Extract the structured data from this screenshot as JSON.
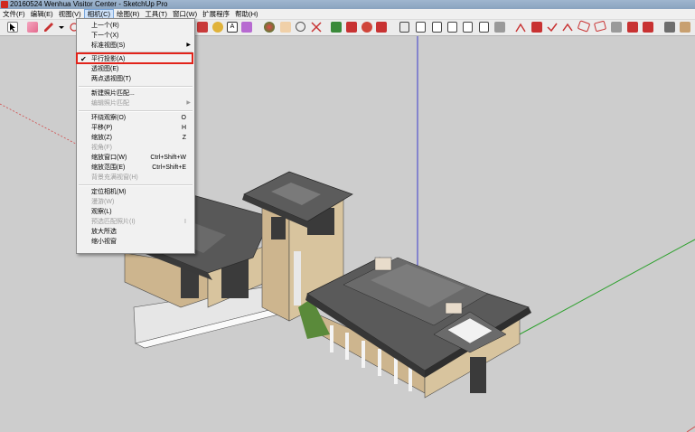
{
  "window": {
    "title": "20160524 Wenhua Visitor Center - SketchUp Pro"
  },
  "menubar": {
    "items": [
      {
        "label": "文件(F)"
      },
      {
        "label": "编辑(E)"
      },
      {
        "label": "视图(V)"
      },
      {
        "label": "相机(C)"
      },
      {
        "label": "绘图(R)"
      },
      {
        "label": "工具(T)"
      },
      {
        "label": "窗口(W)"
      },
      {
        "label": "扩展程序"
      },
      {
        "label": "帮助(H)"
      }
    ]
  },
  "camera_menu": {
    "items": [
      {
        "label": "上一个(R)",
        "shortcut": "",
        "disabled": false,
        "submenu": false,
        "checked": false
      },
      {
        "label": "下一个(X)",
        "shortcut": "",
        "disabled": false,
        "submenu": false,
        "checked": false
      },
      {
        "label": "标准视图(S)",
        "shortcut": "",
        "disabled": false,
        "submenu": true,
        "checked": false
      },
      {
        "label": "平行投影(A)",
        "shortcut": "",
        "disabled": false,
        "submenu": false,
        "checked": true
      },
      {
        "label": "透视图(E)",
        "shortcut": "",
        "disabled": false,
        "submenu": false,
        "checked": false
      },
      {
        "label": "两点透视图(T)",
        "shortcut": "",
        "disabled": false,
        "submenu": false,
        "checked": false
      },
      {
        "label": "新建照片匹配...",
        "shortcut": "",
        "disabled": false,
        "submenu": false,
        "checked": false
      },
      {
        "label": "编辑照片匹配",
        "shortcut": "",
        "disabled": true,
        "submenu": true,
        "checked": false
      },
      {
        "label": "环绕观察(O)",
        "shortcut": "O",
        "disabled": false,
        "submenu": false,
        "checked": false
      },
      {
        "label": "平移(P)",
        "shortcut": "H",
        "disabled": false,
        "submenu": false,
        "checked": false
      },
      {
        "label": "缩放(Z)",
        "shortcut": "Z",
        "disabled": false,
        "submenu": false,
        "checked": false
      },
      {
        "label": "视角(F)",
        "shortcut": "",
        "disabled": true,
        "submenu": false,
        "checked": false
      },
      {
        "label": "缩放窗口(W)",
        "shortcut": "Ctrl+Shift+W",
        "disabled": false,
        "submenu": false,
        "checked": false
      },
      {
        "label": "缩放范围(E)",
        "shortcut": "Ctrl+Shift+E",
        "disabled": false,
        "submenu": false,
        "checked": false
      },
      {
        "label": "背景充满视窗(H)",
        "shortcut": "",
        "disabled": true,
        "submenu": false,
        "checked": false
      },
      {
        "label": "定位相机(M)",
        "shortcut": "",
        "disabled": false,
        "submenu": false,
        "checked": false
      },
      {
        "label": "漫游(W)",
        "shortcut": "",
        "disabled": true,
        "submenu": false,
        "checked": false
      },
      {
        "label": "观察(L)",
        "shortcut": "",
        "disabled": false,
        "submenu": false,
        "checked": false
      },
      {
        "label": "预选匹配照片(I)",
        "shortcut": "I",
        "disabled": true,
        "submenu": false,
        "checked": false
      },
      {
        "label": "放大所选",
        "shortcut": "",
        "disabled": false,
        "submenu": false,
        "checked": false
      },
      {
        "label": "缩小视窗",
        "shortcut": "",
        "disabled": false,
        "submenu": false,
        "checked": false
      }
    ]
  },
  "toolbar": {
    "icons": [
      "select-icon",
      "eraser-icon",
      "pencil-icon",
      "dropdown-arrow-icon",
      "arc-icon",
      "move-icon",
      "push-pull-icon",
      "rotate-icon",
      "follow-me-icon",
      "scale-icon",
      "offset-icon",
      "tape-measure-icon",
      "text-icon",
      "paint-bucket-icon",
      "orbit-icon",
      "pan-icon",
      "zoom-icon",
      "zoom-extents-icon",
      "warehouse-icon",
      "extension-icon",
      "style-icon",
      "component-icon",
      "shadow-icon",
      "section-icon",
      "face-icon",
      "iso-view-icon",
      "top-view-icon",
      "front-view-icon",
      "right-view-icon",
      "back-view-icon",
      "left-view-icon",
      "xray-icon",
      "wireframe-icon",
      "hidden-line-icon",
      "shaded-icon",
      "textured-icon",
      "monochrome-icon",
      "sandbox-icon",
      "stamp-icon",
      "drape-icon",
      "flip-icon",
      "smoove-icon",
      "add-detail-icon",
      "geolocation-icon",
      "model-info-icon"
    ],
    "colors": {
      "accent_red": "#e2231a",
      "accent_blue": "#2c6fc1"
    }
  },
  "viewport": {
    "axis_colors": {
      "red": "#d14a4a",
      "green": "#2ca02c",
      "blue": "#3c3ccd"
    },
    "model": "building-model"
  }
}
